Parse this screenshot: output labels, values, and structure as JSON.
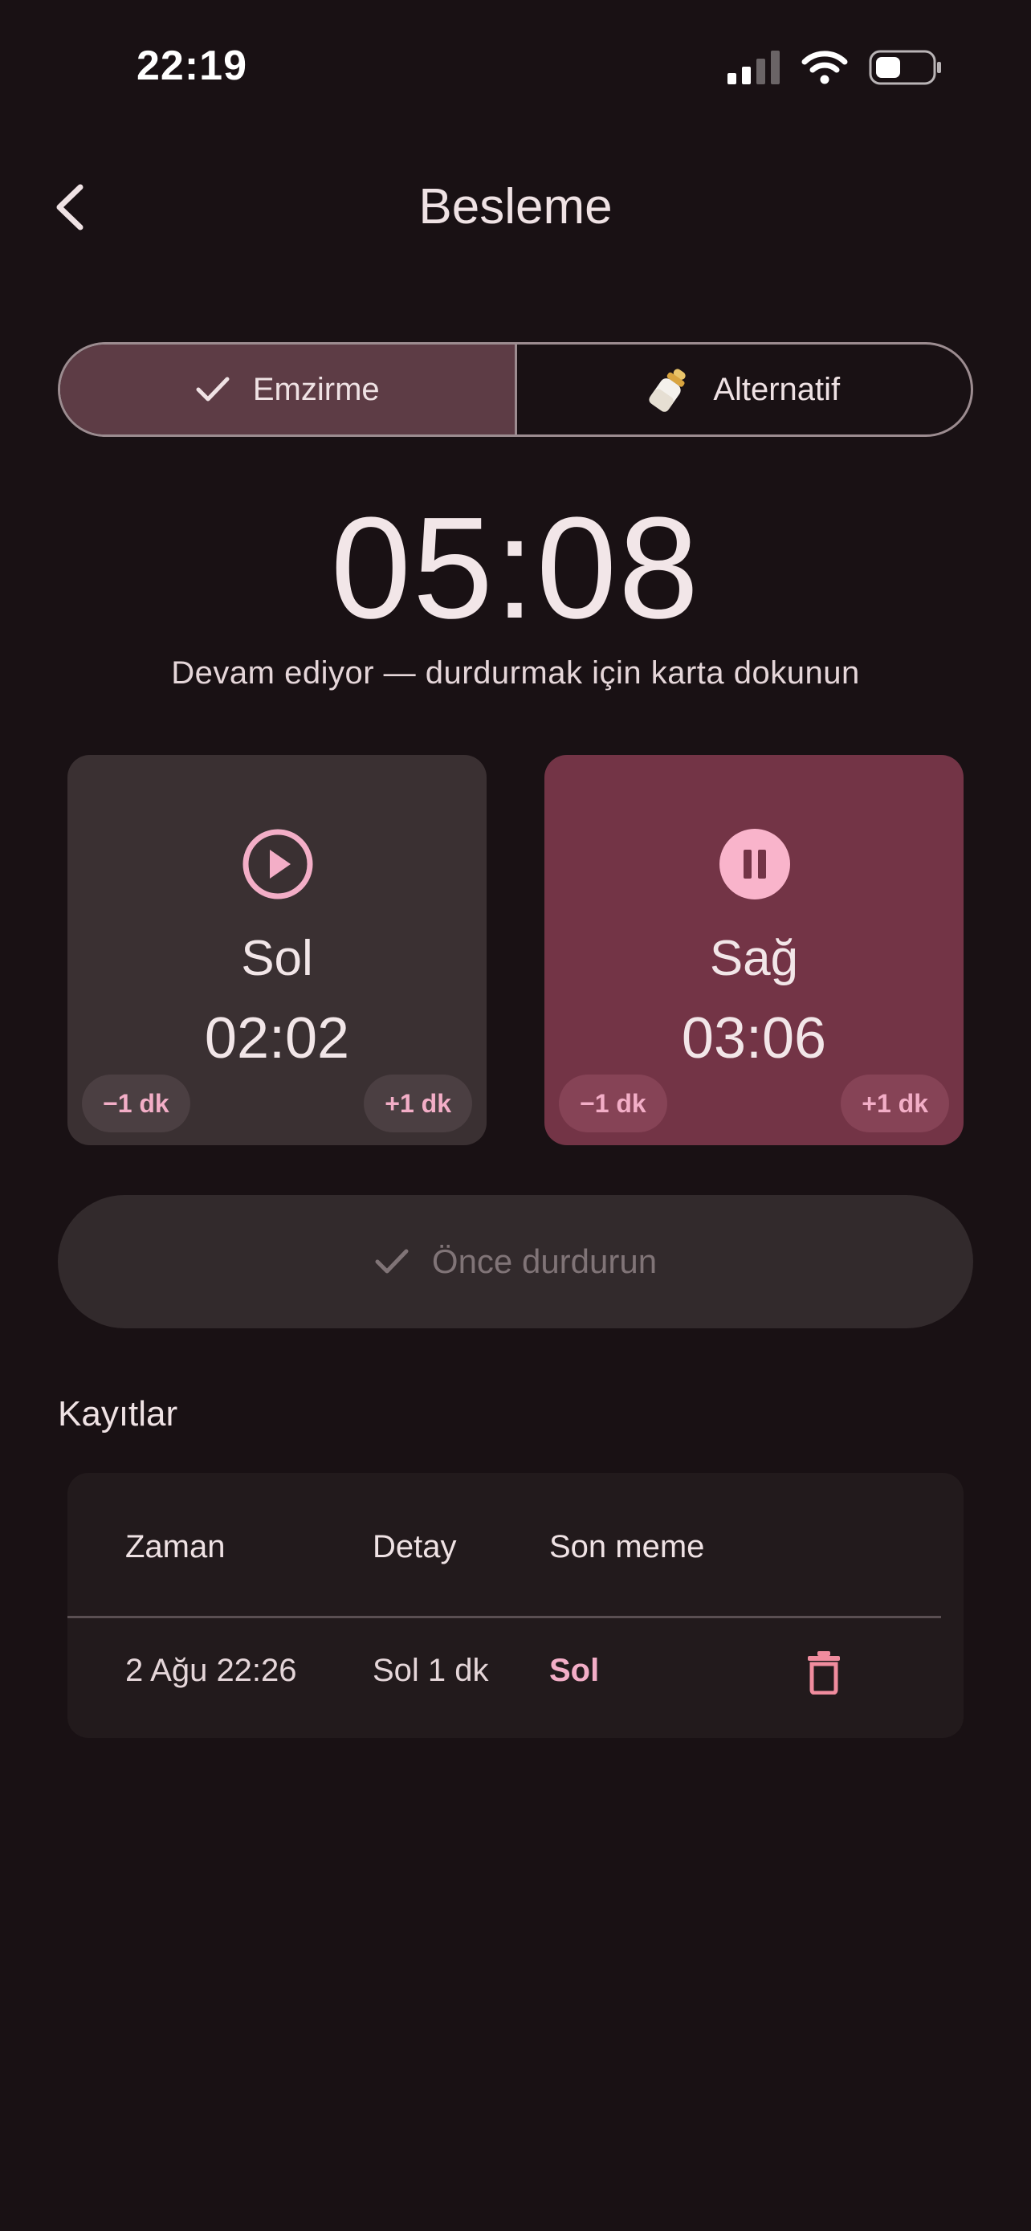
{
  "status_bar": {
    "time": "22:19"
  },
  "header": {
    "title": "Besleme"
  },
  "tabs": [
    {
      "label": "Emzirme",
      "active": true,
      "icon": "check-icon"
    },
    {
      "label": "Alternatif",
      "active": false,
      "icon": "baby-bottle-icon"
    }
  ],
  "timer": {
    "value": "05:08",
    "hint": "Devam ediyor — durdurmak için karta dokunun"
  },
  "sides": {
    "left": {
      "name": "Sol",
      "time": "02:02",
      "minus_label": "−1 dk",
      "plus_label": "+1 dk",
      "state_icon": "play-icon"
    },
    "right": {
      "name": "Sağ",
      "time": "03:06",
      "minus_label": "−1 dk",
      "plus_label": "+1 dk",
      "state_icon": "pause-icon"
    }
  },
  "primary_button": {
    "label": "Önce durdurun",
    "icon": "check-icon"
  },
  "records": {
    "title": "Kayıtlar",
    "headers": {
      "time": "Zaman",
      "detail": "Detay",
      "last": "Son meme"
    },
    "rows": [
      {
        "time": "2 Ağu 22:26",
        "detail": "Sol 1 dk",
        "last": "Sol"
      }
    ]
  },
  "colors": {
    "background": "#191114",
    "accent": "#f3aec7",
    "active_card": "#733446",
    "inactive_card": "#3a3032"
  }
}
